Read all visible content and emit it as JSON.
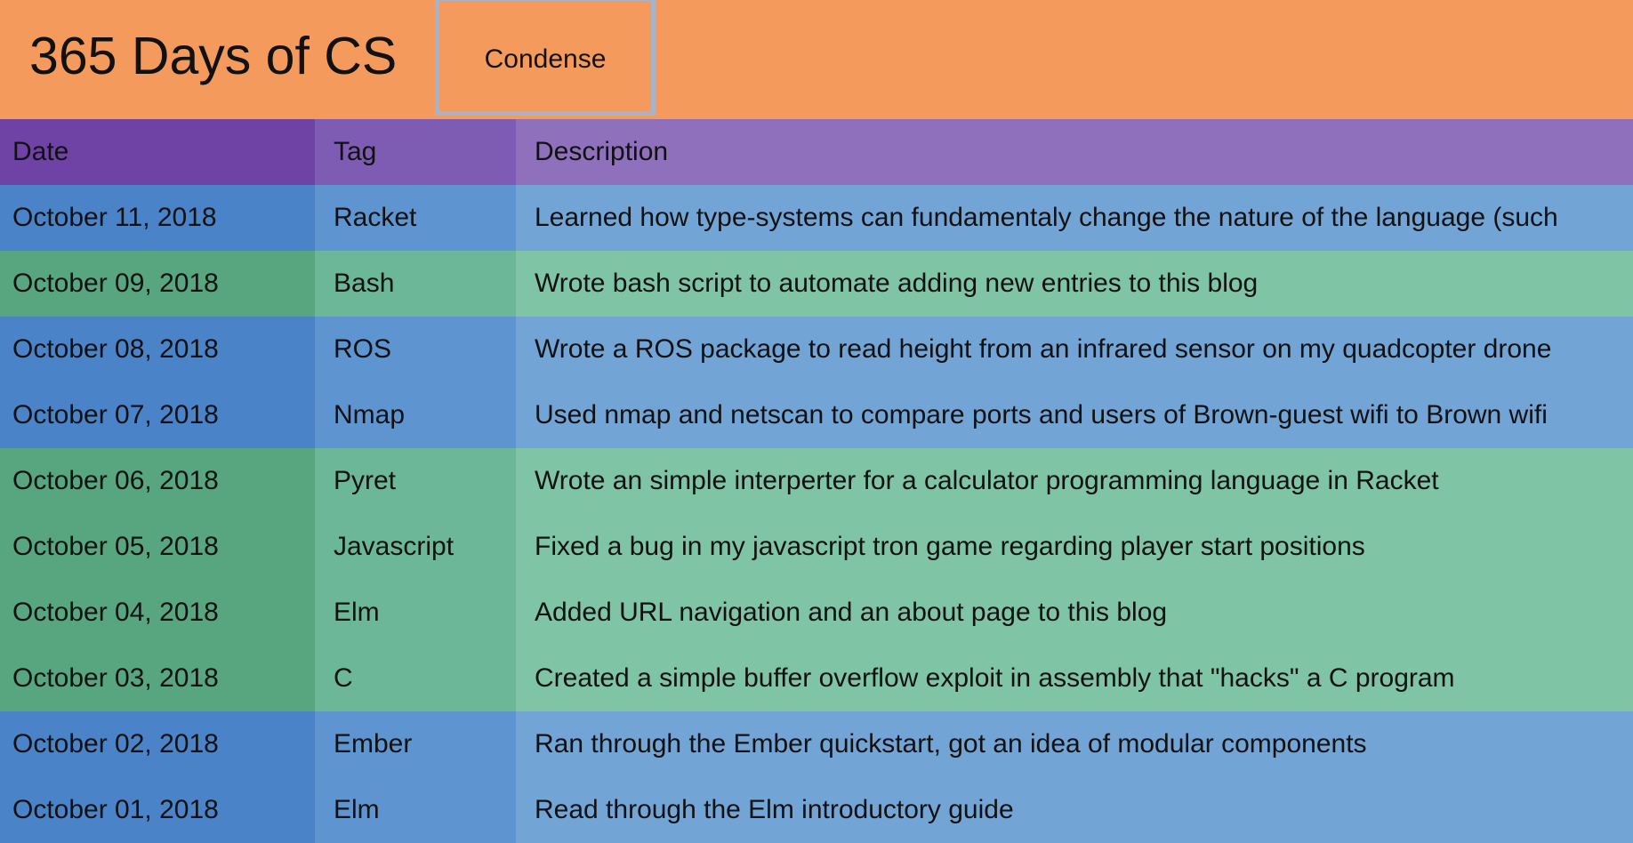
{
  "header": {
    "title": "365 Days of CS",
    "condense_label": "Condense"
  },
  "table": {
    "columns": {
      "date": "Date",
      "tag": "Tag",
      "description": "Description"
    },
    "rows": [
      {
        "date": "October 11, 2018",
        "tag": "Racket",
        "description": "Learned how type-systems can fundamentaly change the nature of the language (such",
        "color": "blue"
      },
      {
        "date": "October 09, 2018",
        "tag": "Bash",
        "description": "Wrote bash script to automate adding new entries to this blog",
        "color": "green"
      },
      {
        "date": "October 08, 2018",
        "tag": "ROS",
        "description": "Wrote a ROS package to read height from an infrared sensor on my quadcopter drone",
        "color": "blue"
      },
      {
        "date": "October 07, 2018",
        "tag": "Nmap",
        "description": "Used nmap and netscan to compare ports and users of Brown-guest wifi to Brown wifi",
        "color": "blue"
      },
      {
        "date": "October 06, 2018",
        "tag": "Pyret",
        "description": "Wrote an simple interperter for a calculator programming language in Racket",
        "color": "green"
      },
      {
        "date": "October 05, 2018",
        "tag": "Javascript",
        "description": "Fixed a bug in my javascript tron game regarding player start positions",
        "color": "green"
      },
      {
        "date": "October 04, 2018",
        "tag": "Elm",
        "description": "Added URL navigation and an about page to this blog",
        "color": "green"
      },
      {
        "date": "October 03, 2018",
        "tag": "C",
        "description": "Created a simple buffer overflow exploit in assembly that \"hacks\" a C program",
        "color": "green"
      },
      {
        "date": "October 02, 2018",
        "tag": "Ember",
        "description": "Ran through the Ember quickstart, got an idea of modular components",
        "color": "blue"
      },
      {
        "date": "October 01, 2018",
        "tag": "Elm",
        "description": "Read through the Elm introductory guide",
        "color": "blue"
      }
    ]
  },
  "colors": {
    "header_background": "#f39a5c",
    "blue_row": "#72a4d6",
    "green_row": "#7ec4a5",
    "header_row": "#8f70bd"
  }
}
